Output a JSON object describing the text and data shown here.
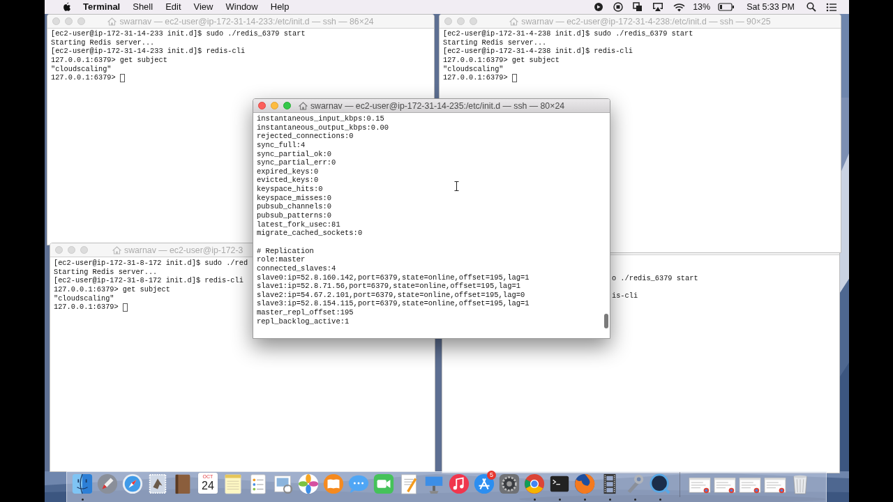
{
  "menu_bar": {
    "app": "Terminal",
    "menus": [
      "Shell",
      "Edit",
      "View",
      "Window",
      "Help"
    ],
    "battery": "13%",
    "clock": "Sat 5:33 PM"
  },
  "windows": [
    {
      "title": "swarnav — ec2-user@ip-172-31-14-233:/etc/init.d — ssh — 86×24",
      "active": false,
      "cursor": true,
      "sections": [
        [
          "[ec2-user@ip-172-31-14-233 init.d]$ sudo ./redis_6379 start",
          "Starting Redis server...",
          "[ec2-user@ip-172-31-14-233 init.d]$ redis-cli",
          "127.0.0.1:6379> get subject",
          "\"cloudscaling\"",
          "127.0.0.1:6379> "
        ]
      ]
    },
    {
      "title": "swarnav — ec2-user@ip-172-31-4-238:/etc/init.d — ssh — 90×25",
      "active": false,
      "cursor": true,
      "sections": [
        [
          "[ec2-user@ip-172-31-4-238 init.d]$ sudo ./redis_6379 start",
          "Starting Redis server...",
          "[ec2-user@ip-172-31-4-238 init.d]$ redis-cli",
          "127.0.0.1:6379> get subject",
          "\"cloudscaling\"",
          "127.0.0.1:6379> "
        ]
      ]
    },
    {
      "title": "swarnav — ec2-user@ip-172-3",
      "active": false,
      "cursor": true,
      "sections": [
        [
          "[ec2-user@ip-172-31-8-172 init.d]$ sudo ./red",
          "Starting Redis server...",
          "[ec2-user@ip-172-31-8-172 init.d]$ redis-cli",
          "127.0.0.1:6379> get subject",
          "\"cloudscaling\"",
          "127.0.0.1:6379> "
        ]
      ]
    },
    {
      "active": false,
      "cursor": false,
      "sections": [
        [
          "o ./redis_6379 start"
        ],
        [
          "is-cli"
        ]
      ]
    },
    {
      "title": "swarnav — ec2-user@ip-172-31-14-235:/etc/init.d — ssh — 80×24",
      "active": true,
      "cursor": false,
      "sections": [
        [
          "instantaneous_input_kbps:0.15",
          "instantaneous_output_kbps:0.00",
          "rejected_connections:0",
          "sync_full:4",
          "sync_partial_ok:0",
          "sync_partial_err:0",
          "expired_keys:0",
          "evicted_keys:0",
          "keyspace_hits:0",
          "keyspace_misses:0",
          "pubsub_channels:0",
          "pubsub_patterns:0",
          "latest_fork_usec:81",
          "migrate_cached_sockets:0"
        ],
        [
          "# Replication",
          "role:master",
          "connected_slaves:4",
          "slave0:ip=52.8.160.142,port=6379,state=online,offset=195,lag=1",
          "slave1:ip=52.8.71.56,port=6379,state=online,offset=195,lag=1",
          "slave2:ip=54.67.2.101,port=6379,state=online,offset=195,lag=0",
          "slave3:ip=52.8.154.115,port=6379,state=online,offset=195,lag=1",
          "master_repl_offset:195",
          "repl_backlog_active:1"
        ]
      ]
    }
  ],
  "dock": {
    "items": [
      {
        "kind": "finder",
        "running": true
      },
      {
        "kind": "launchpad",
        "running": false
      },
      {
        "kind": "safari",
        "running": false
      },
      {
        "kind": "stamp",
        "running": false
      },
      {
        "kind": "notebook",
        "running": false
      },
      {
        "kind": "calendar",
        "running": false,
        "month": "OCT",
        "day": "24"
      },
      {
        "kind": "notes",
        "running": false
      },
      {
        "kind": "reminders",
        "running": false
      },
      {
        "kind": "preview",
        "running": false
      },
      {
        "kind": "photos",
        "running": false
      },
      {
        "kind": "books",
        "running": false
      },
      {
        "kind": "messages",
        "running": false
      },
      {
        "kind": "facetime",
        "running": false
      },
      {
        "kind": "pages",
        "running": false
      },
      {
        "kind": "keynote",
        "running": false
      },
      {
        "kind": "music",
        "running": false
      },
      {
        "kind": "appstore",
        "running": false,
        "badge": "5"
      },
      {
        "kind": "settings",
        "running": false
      },
      {
        "kind": "chrome",
        "running": true
      },
      {
        "kind": "terminal",
        "running": true
      },
      {
        "kind": "firefox",
        "running": true
      },
      {
        "kind": "film",
        "running": true
      },
      {
        "kind": "tool",
        "running": true
      },
      {
        "kind": "quicktime",
        "running": true
      },
      {
        "kind": "separator"
      },
      {
        "kind": "thumbnail",
        "running": false
      },
      {
        "kind": "thumbnail",
        "running": false
      },
      {
        "kind": "thumbnail",
        "running": false
      },
      {
        "kind": "thumbnail",
        "running": false
      },
      {
        "kind": "trash",
        "running": false
      }
    ]
  }
}
